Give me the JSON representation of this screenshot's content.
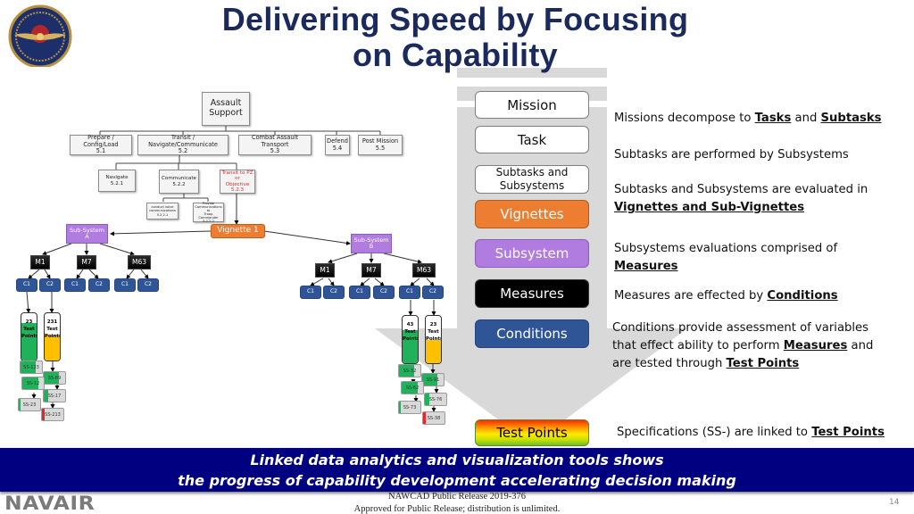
{
  "slide": {
    "title_line1": "Delivering Speed by Focusing",
    "title_line2": "on Capability",
    "logo_icon": "naval-air-systems-command-seal-icon",
    "page_number": "14"
  },
  "hierarchy": {
    "pills": [
      {
        "label": "Mission",
        "style": "white"
      },
      {
        "label": "Task",
        "style": "white"
      },
      {
        "label_line1": "Subtasks and",
        "label_line2": "Subsystems",
        "style": "white"
      },
      {
        "label": "Vignettes",
        "style": "orange"
      },
      {
        "label": "Subsystem",
        "style": "purple"
      },
      {
        "label": "Measures",
        "style": "black"
      },
      {
        "label": "Conditions",
        "style": "blue"
      },
      {
        "label": "Test Points",
        "style": "rainbow"
      }
    ],
    "arrow_icon": "down-arrow-icon"
  },
  "descriptions": {
    "d1": {
      "pre": "Missions decompose to ",
      "b1": "Tasks",
      "mid": " and ",
      "b2": "Subtasks"
    },
    "d2": {
      "text": "Subtasks are performed by Subsystems"
    },
    "d3": {
      "line1": "Subtasks and Subsystems are evaluated in",
      "b1": "Vignettes and Sub-Vignettes"
    },
    "d4": {
      "line1": "Subsystems evaluations comprised of",
      "b1": "Measures"
    },
    "d5": {
      "pre": "Measures are effected by ",
      "b1": "Conditions"
    },
    "d6": {
      "line1": "Conditions provide assessment of variables",
      "line2_pre": "that effect ability to perform ",
      "line2_b": "Measures",
      "line2_post": " and",
      "line3_pre": "are tested through ",
      "line3_b": "Test Points"
    },
    "d7": {
      "pre": "Specifications (SS-) are linked to ",
      "b1": "Test Points"
    }
  },
  "tree": {
    "root": {
      "line1": "Assault",
      "line2": "Support"
    },
    "level1": [
      {
        "name": "Prepare / Config/Load",
        "id": "5.1"
      },
      {
        "name": "Transit / Navigate/Communicate",
        "id": "5.2"
      },
      {
        "name": "Combat Assault Transport",
        "id": "5.3"
      },
      {
        "name": "Defend",
        "id": "5.4"
      },
      {
        "name": "Post Mission",
        "id": "5.5"
      }
    ],
    "level2": [
      {
        "name": "Navigate",
        "id": "5.2.1"
      },
      {
        "name": "Communicate",
        "id": "5.2.2"
      },
      {
        "name_line1": "Transit to PZ or",
        "name_line2": "Objective",
        "id": "5.2.3"
      }
    ],
    "level3": [
      {
        "name_line1": "conduct voice",
        "name_line2": "communications",
        "id": "5.2.2.1"
      },
      {
        "name_line1": "Provide",
        "name_line2": "Communications to",
        "name_line3": "Troop Commander",
        "id": "5.2.2.2"
      }
    ],
    "vignette": "Vignette 1",
    "subsystem_a": {
      "line1": "Sub-System",
      "line2": "A"
    },
    "subsystem_b": {
      "line1": "Sub-System",
      "line2": "B"
    },
    "measures": [
      "M1",
      "M7",
      "M63"
    ],
    "conditions": [
      "C1",
      "C2"
    ],
    "test_points_a": [
      {
        "count": "23",
        "line2": "Test",
        "line3": "Points",
        "fill_percent": 80,
        "color": "#1fb25a"
      },
      {
        "count": "231",
        "line2": "Test",
        "line3": "Points",
        "fill_percent": 55,
        "color": "#ffc000"
      }
    ],
    "test_points_b": [
      {
        "count": "43",
        "line2": "Test",
        "line3": "Points",
        "fill_percent": 70,
        "color": "#1fb25a"
      },
      {
        "count": "23",
        "line2": "Test",
        "line3": "Points",
        "fill_percent": 50,
        "color": "#ffc000"
      }
    ],
    "specs_a": [
      {
        "label": "SS-123",
        "fill_percent": 70,
        "color": "#1fb25a"
      },
      {
        "label": "SS-89",
        "fill_percent": 70,
        "color": "#1fb25a"
      },
      {
        "label": "SS-12",
        "fill_percent": 75,
        "color": "#1fb25a"
      },
      {
        "label": "SS-17",
        "fill_percent": 20,
        "color": "#1fb25a"
      },
      {
        "label": "SS-23",
        "fill_percent": 8,
        "color": "#1fb25a"
      },
      {
        "label": "SS-213",
        "fill_percent": 12,
        "color": "#e8262a"
      }
    ],
    "specs_b": [
      {
        "label": "SS-32",
        "fill_percent": 70,
        "color": "#1fb25a"
      },
      {
        "label": "SS-91",
        "fill_percent": 70,
        "color": "#1fb25a"
      },
      {
        "label": "SS-62",
        "fill_percent": 75,
        "color": "#1fb25a"
      },
      {
        "label": "SS-76",
        "fill_percent": 20,
        "color": "#1fb25a"
      },
      {
        "label": "SS-73",
        "fill_percent": 8,
        "color": "#1fb25a"
      },
      {
        "label": "SS-38",
        "fill_percent": 12,
        "color": "#e8262a"
      }
    ]
  },
  "banner": {
    "line1": "Linked data analytics and visualization tools shows",
    "line2": "the progress of capability development accelerating decision making"
  },
  "footer": {
    "brand": "NAVAIR",
    "release_line1": "NAWCAD Public Release 2019-376",
    "release_line2": "Approved for Public Release; distribution is unlimited."
  }
}
